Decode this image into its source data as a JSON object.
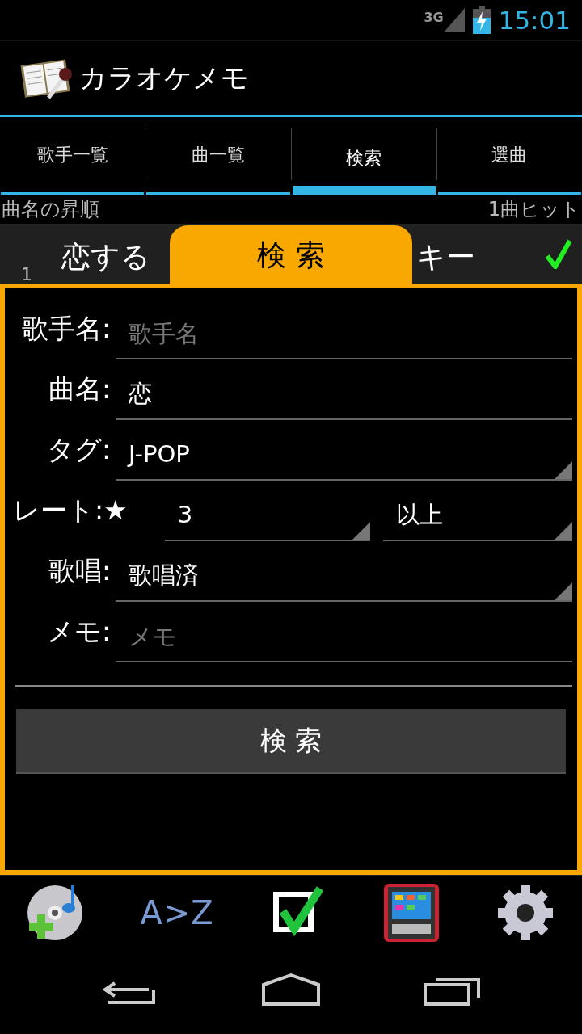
{
  "status_bar": {
    "network": "3G",
    "time": "15:01"
  },
  "app_bar": {
    "title": "カラオケメモ"
  },
  "tabs": [
    {
      "label": "歌手一覧",
      "selected": false
    },
    {
      "label": "曲一覧",
      "selected": false
    },
    {
      "label": "検索",
      "selected": true
    },
    {
      "label": "選曲",
      "selected": false
    }
  ],
  "list_header": {
    "sort": "曲名の昇順",
    "hits": "1曲ヒット"
  },
  "song_row": {
    "number": "1",
    "title": "恋する",
    "key": "キー",
    "checked": true
  },
  "search_panel": {
    "title": "検 索",
    "fields": [
      {
        "label": "歌手名:",
        "kind": "text",
        "placeholder": "歌手名"
      },
      {
        "label": "曲名:",
        "kind": "text",
        "value": "恋"
      },
      {
        "label": "タグ:",
        "kind": "select",
        "value": "J-POP"
      },
      {
        "label": "レート:★",
        "kind": "rating",
        "value": "3",
        "qualifier": "以上"
      },
      {
        "label": "歌唱:",
        "kind": "select",
        "value": "歌唱済"
      },
      {
        "label": "メモ:",
        "kind": "text",
        "placeholder": "メモ"
      }
    ],
    "button": "検 索"
  },
  "toolbar": {
    "sort_label": "A>Z"
  }
}
